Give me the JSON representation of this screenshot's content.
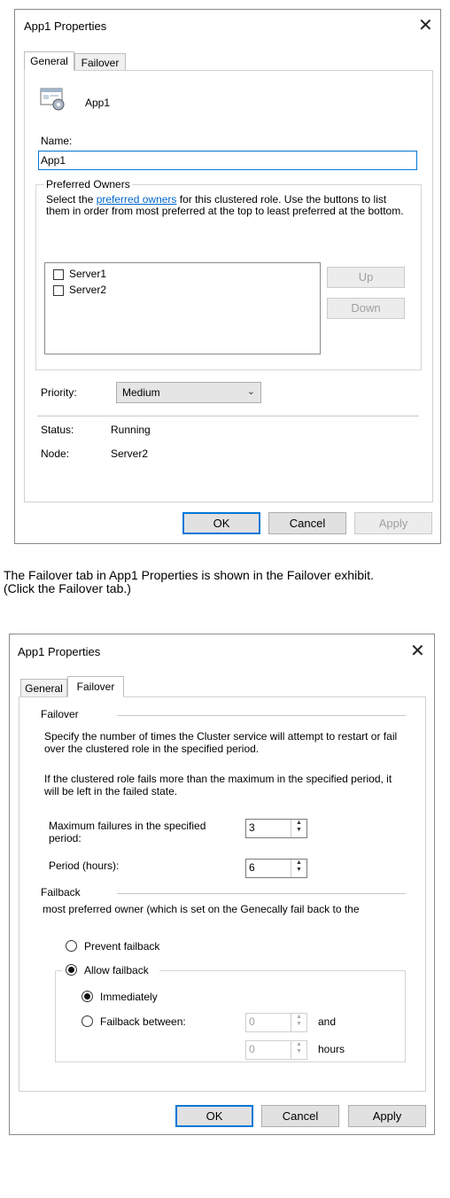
{
  "general_dialog": {
    "title": "App1 Properties",
    "tabs": [
      "General",
      "Failover"
    ],
    "role_name": "App1",
    "name_label": "Name:",
    "name_value": "App1",
    "preferred_owners": {
      "group_label": "Preferred Owners",
      "desc_before": "Select the ",
      "desc_link": "preferred owners",
      "desc_after": " for this clustered role. Use the buttons to list them in order from most preferred at the top to least preferred at the bottom.",
      "servers": [
        {
          "label": "Server1",
          "checked": false
        },
        {
          "label": "Server2",
          "checked": false
        }
      ],
      "up_label": "Up",
      "down_label": "Down"
    },
    "priority_label": "Priority:",
    "priority_value": "Medium",
    "status_label": "Status:",
    "status_value": "Running",
    "node_label": "Node:",
    "node_value": "Server2",
    "buttons": {
      "ok": "OK",
      "cancel": "Cancel",
      "apply": "Apply"
    }
  },
  "caption": {
    "line1": "The Failover tab in App1 Properties is shown in the Failover exhibit.",
    "line2": "(Click the Failover tab.)"
  },
  "failover_dialog": {
    "title": "App1 Properties",
    "tabs": [
      "General",
      "Failover"
    ],
    "failover_group": "Failover",
    "desc1": "Specify the number of times the Cluster service will attempt to restart or fail over the clustered role in the specified period.",
    "desc2": "If the clustered role fails more than the maximum in the specified period, it will be left in the failed state.",
    "max_failures_label": "Maximum failures in the specified period:",
    "max_failures_value": "3",
    "period_label": "Period (hours):",
    "period_value": "6",
    "failback_group": "Failback",
    "failback_desc": "most preferred owner (which is set on the Genecally fail back to the",
    "prevent_label": "Prevent failback",
    "allow_label": "Allow failback",
    "immediately_label": "Immediately",
    "between_label": "Failback between:",
    "between_from": "0",
    "between_to": "0",
    "and_label": "and",
    "hours_label": "hours",
    "selected_failback": "Allow failback",
    "selected_timing": "Immediately",
    "buttons": {
      "ok": "OK",
      "cancel": "Cancel",
      "apply": "Apply"
    }
  }
}
